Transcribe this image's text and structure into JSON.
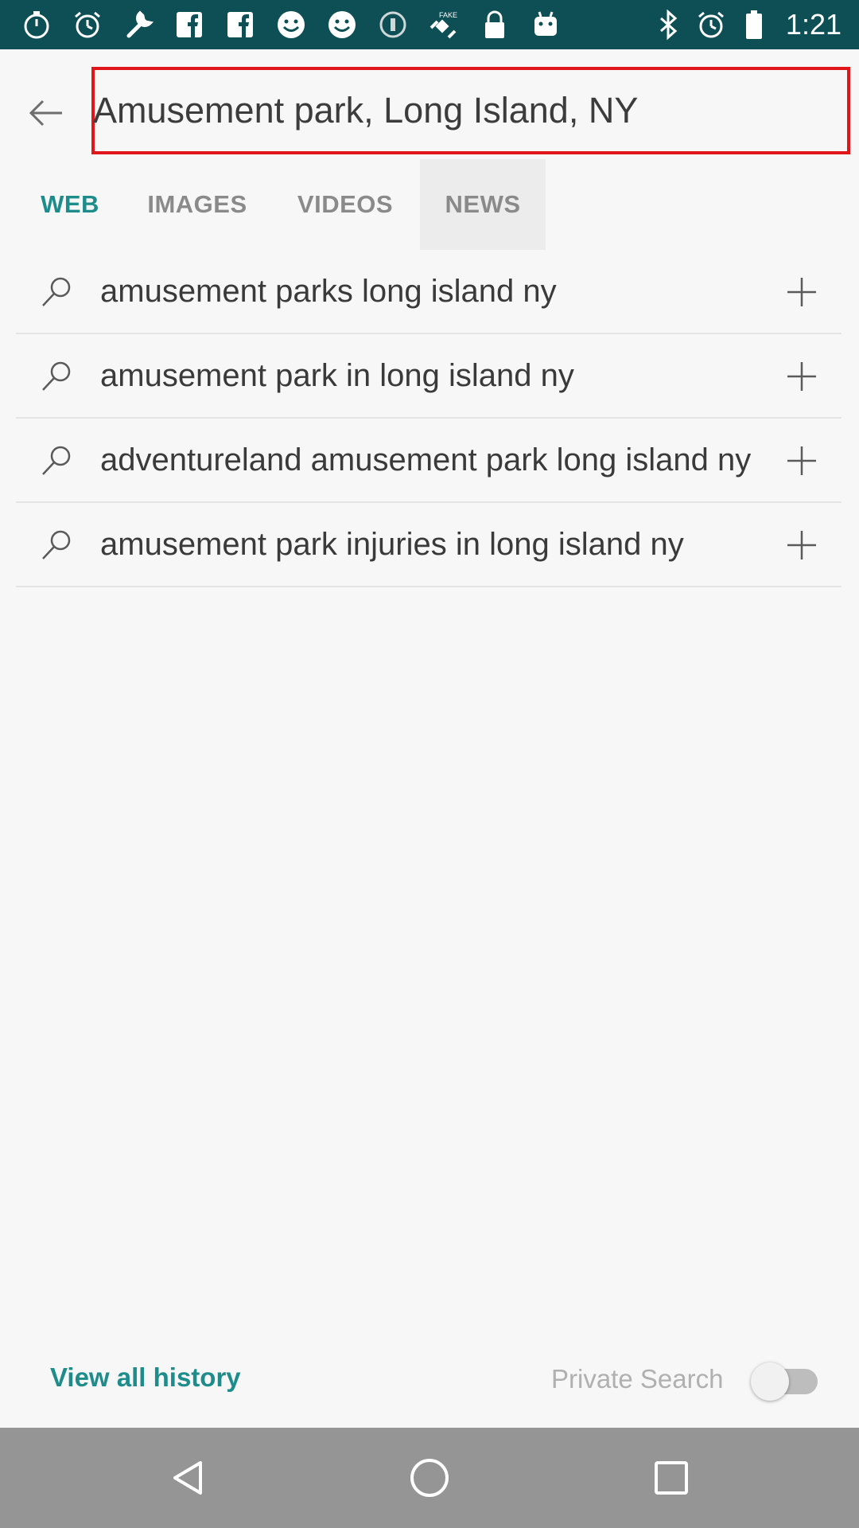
{
  "status_bar": {
    "time": "1:21",
    "left_icons": [
      "stopwatch-icon",
      "alarm-icon",
      "wrench-icon",
      "facebook-icon",
      "facebook-icon",
      "smiley-icon",
      "smiley-icon",
      "info-icon",
      "fake-gps-icon",
      "lock-icon",
      "android-icon"
    ],
    "right_icons": [
      "bluetooth-icon",
      "alarm-icon",
      "battery-icon"
    ]
  },
  "search": {
    "value": "Amusement park, Long Island, NY"
  },
  "tabs": [
    {
      "label": "WEB"
    },
    {
      "label": "IMAGES"
    },
    {
      "label": "VIDEOS"
    },
    {
      "label": "NEWS"
    }
  ],
  "suggestions": [
    {
      "text": "amusement parks long island ny"
    },
    {
      "text": "amusement park in long island ny"
    },
    {
      "text": "adventureland amusement park long island ny"
    },
    {
      "text": "amusement park injuries in long island ny"
    }
  ],
  "footer": {
    "view_all_history": "View all history",
    "private_search": "Private Search",
    "private_search_enabled": false
  },
  "colors": {
    "accent": "#1f8c8c",
    "status_bar": "#0d4f55",
    "highlight_border": "#e0161b",
    "nav_bar": "#959595"
  }
}
